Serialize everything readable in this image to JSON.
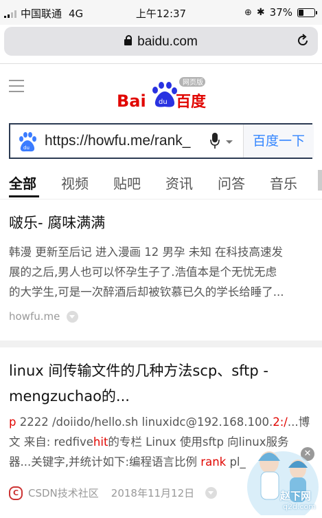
{
  "status_bar": {
    "carrier": "中国联通",
    "network": "4G",
    "time": "上午12:37",
    "battery_percent": "37%",
    "battery_level": 0.37
  },
  "browser": {
    "url": "baidu.com"
  },
  "baidu": {
    "logo_text": "Bai百度",
    "logo_badge": "网页版",
    "search_query": "https://howfu.me/rank_",
    "search_button": "百度一下",
    "tabs": [
      "全部",
      "视频",
      "贴吧",
      "资讯",
      "问答",
      "音乐"
    ]
  },
  "results": [
    {
      "title": "啵乐- 腐味满满",
      "snippet_lines": [
        "韩漫 更新至后记 进入漫画 12 男孕 未知 在科技高速发",
        "展的之后,男人也可以怀孕生子了.浩值本是个无忧无虑",
        "的大学生,可是一次醉酒后却被钦慕已久的学长给睡了..."
      ],
      "source": "howfu.me"
    },
    {
      "title_lines": [
        "linux 间传输文件的几种方法scp、sftp -",
        "mengzuchao的..."
      ],
      "snippet_line1": {
        "p": "p",
        "a": " 2222 /doiido/hello.sh linuxidc@192.168.100.",
        "b": "2:/",
        "c": "...博"
      },
      "snippet_line2": {
        "a": "文 来自: redfive",
        "b": "hit",
        "c": "的专栏 Linux 使用sftp 向linux服务"
      },
      "snippet_line3": {
        "a": "器...关键字,并统计如下:编程语言比例 ",
        "b": "rank",
        "c": " pl_"
      },
      "source": "CSDN技术社区",
      "date": "2018年11月12日"
    }
  ],
  "watermark": {
    "text": "赵下网",
    "domain": "q2d.com"
  }
}
